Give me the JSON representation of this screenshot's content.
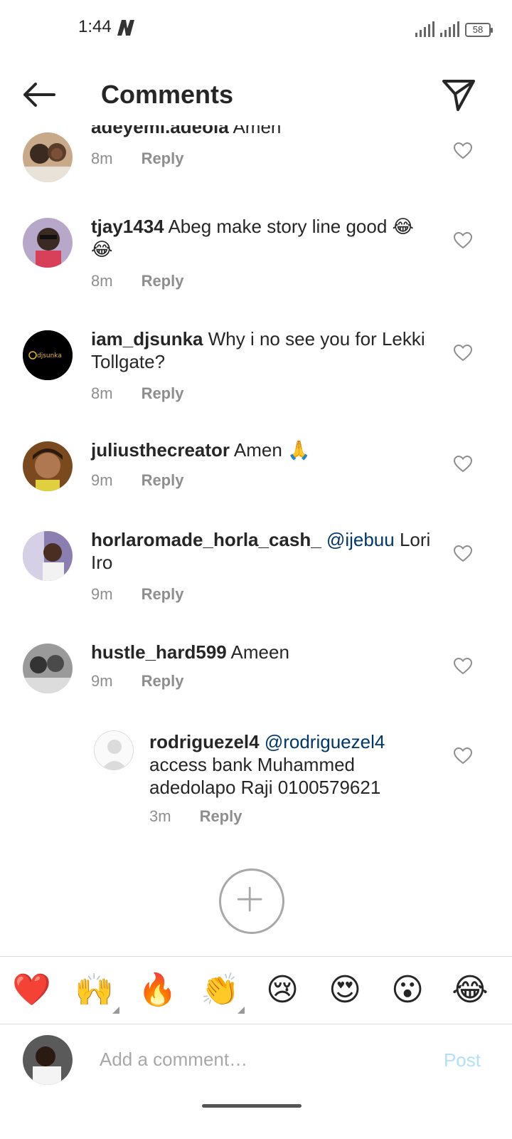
{
  "status_bar": {
    "time": "1:44",
    "battery": "58"
  },
  "header": {
    "title": "Comments"
  },
  "comments": [
    {
      "username": "adeyemi.adeola",
      "text": "Amen",
      "time": "8m",
      "reply": "Reply"
    },
    {
      "username": "tjay1434",
      "text": "Abeg make story line good 😂😂",
      "time": "8m",
      "reply": "Reply"
    },
    {
      "username": "iam_djsunka",
      "text": "Why i no see you for Lekki Tollgate?",
      "time": "8m",
      "reply": "Reply"
    },
    {
      "username": "juliusthecreator",
      "text": "Amen 🙏",
      "time": "9m",
      "reply": "Reply"
    },
    {
      "username": "horlaromade_horla_cash_",
      "mention": "@ijebuu",
      "text": "Lori Iro",
      "time": "9m",
      "reply": "Reply"
    },
    {
      "username": "hustle_hard599",
      "text": "Ameen",
      "time": "9m",
      "reply": "Reply"
    },
    {
      "username": "rodriguezel4",
      "mention": "@rodriguezel4",
      "text": "access bank Muhammed adedolapo Raji 0100579621",
      "time": "3m",
      "reply": "Reply"
    }
  ],
  "avatar_labels": {
    "djsunka_logo": "djsunka"
  },
  "emoji_bar": [
    "❤️",
    "🙌",
    "🔥",
    "👏",
    "😢",
    "😍",
    "😮",
    "😂"
  ],
  "composer": {
    "placeholder": "Add a comment…",
    "post_label": "Post"
  },
  "colors": {
    "mention": "#00376b",
    "meta": "#8e8e8e",
    "post_disabled": "#b2dffc"
  }
}
